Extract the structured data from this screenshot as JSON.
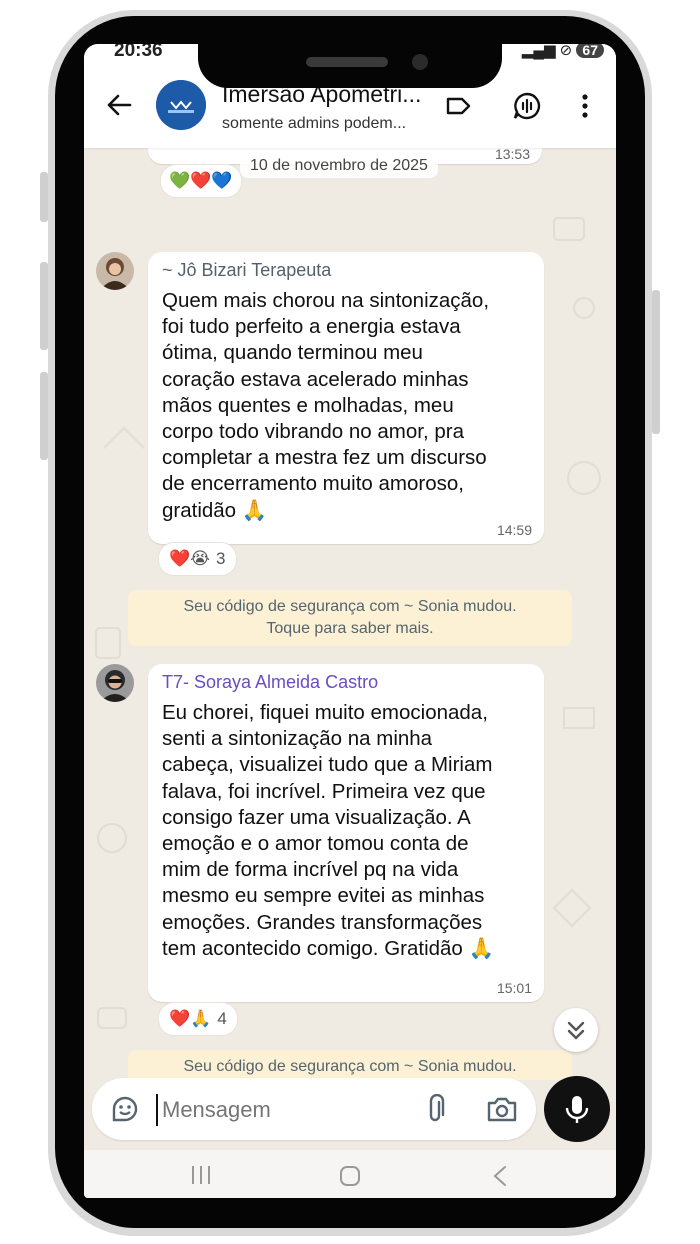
{
  "status": {
    "time": "20:36",
    "battery": "67"
  },
  "header": {
    "title": "Imersão Apometri...",
    "subtitle": "somente admins podem...",
    "avatar_text": "IMERSÃO APOMETRIA"
  },
  "chat": {
    "prev_time": "13:53",
    "date_chip": "10 de novembro de 2025",
    "messages": [
      {
        "sender": "~ Jô Bizari Terapeuta",
        "lines": "Quem mais chorou na sintonização,\nfoi tudo perfeito a energia estava\nótima, quando terminou meu\ncoração estava acelerado minhas\nmãos quentes e molhadas, meu\ncorpo todo vibrando no amor, pra\ncompletar a mestra fez um discurso\nde encerramento muito amoroso,\ngratidão 🙏",
        "time": "14:59",
        "reactions": "❤️😭",
        "reaction_count": "3"
      },
      {
        "sender": "T7- Soraya Almeida Castro",
        "lines": "Eu chorei, fiquei muito emocionada,\nsenti a sintonização na minha\ncabeça,  visualizei tudo que a Miriam\nfalava, foi incrível. Primeira vez que\nconsigo fazer uma visualização. A\nemoção e o amor tomou conta de\nmim de forma incrível pq na vida\nmesmo eu sempre evitei as minhas\nemoções. Grandes transformações\ntem acontecido comigo. Gratidão 🙏",
        "time": "15:01",
        "reactions": "❤️🙏",
        "reaction_count": "4"
      }
    ],
    "system_notice_1": "Seu código de segurança com ~ Sonia mudou.",
    "system_notice_2": "Toque para saber mais."
  },
  "composer": {
    "placeholder": "Mensagem"
  },
  "colors": {
    "sender1": "#55606b",
    "sender2": "#6a4cc4",
    "bubble": "#ffffff",
    "wallpaper": "#efeae2",
    "notice": "#fdf1d5"
  }
}
